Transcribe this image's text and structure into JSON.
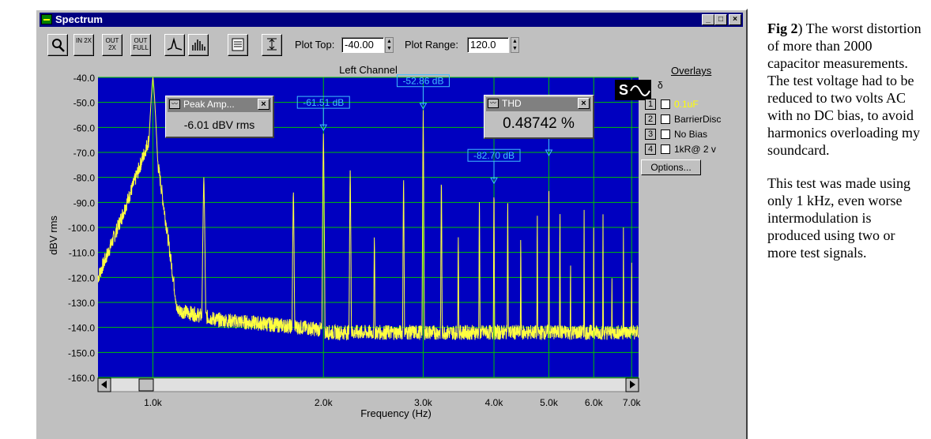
{
  "window": {
    "title": "Spectrum",
    "caption_buttons": [
      "_",
      "□",
      "×"
    ]
  },
  "toolbar": {
    "buttons": [
      {
        "name": "zoom",
        "label": ""
      },
      {
        "name": "zoom-in-2x",
        "label": "IN 2X"
      },
      {
        "name": "zoom-out-2x",
        "label": "OUT 2X"
      },
      {
        "name": "zoom-out-full",
        "label": "OUT FULL"
      },
      {
        "name": "line-mode",
        "label": ""
      },
      {
        "name": "bar-mode",
        "label": ""
      },
      {
        "name": "settings",
        "label": ""
      },
      {
        "name": "autoscale",
        "label": ""
      }
    ],
    "plot_top_label": "Plot Top:",
    "plot_top_value": "-40.00",
    "plot_range_label": "Plot Range:",
    "plot_range_value": "120.0"
  },
  "plot": {
    "channel_title": "Left Channel",
    "ylabel": "dBV rms",
    "xlabel": "Frequency (Hz)",
    "yticks": [
      "-40.0",
      "-50.0",
      "-60.0",
      "-70.0",
      "-80.0",
      "-90.0",
      "-100.0",
      "-110.0",
      "-120.0",
      "-130.0",
      "-140.0",
      "-150.0",
      "-160.0"
    ],
    "xticks": [
      "1.0k",
      "2.0k",
      "3.0k",
      "4.0k",
      "5.0k",
      "6.0k",
      "7.0k"
    ],
    "background_color": "#0000c0",
    "grid_color": "#00c000",
    "trace_color": "#ffff40",
    "markers": [
      {
        "label": "-61.51 dB",
        "freq": 2000,
        "db": -61.51
      },
      {
        "label": "-52.86 dB",
        "freq": 3000,
        "db": -52.86
      },
      {
        "label": "-82.70 dB",
        "freq": 4000,
        "db": -82.7
      }
    ]
  },
  "chart_data": {
    "type": "line",
    "title": "Left Channel",
    "xlabel": "Frequency (Hz)",
    "ylabel": "dBV rms",
    "ylim": [
      -160,
      -40
    ],
    "xscale": "log",
    "grid": true,
    "series": [
      {
        "values_description_peaks": "peaks",
        "x": [
          1000,
          1230,
          1770,
          2000,
          2230,
          2460,
          2770,
          3000,
          3230,
          3460,
          3770,
          4000,
          4230,
          4460,
          4770,
          5000,
          5230,
          5460,
          5770,
          6000,
          6230,
          6460,
          6770,
          7000
        ],
        "y": [
          -40,
          -80,
          -85,
          -61.5,
          -77,
          -103,
          -79,
          -52.9,
          -79,
          -103,
          -86,
          -82.7,
          -86,
          -102,
          -93,
          -78,
          -91,
          -110,
          -93,
          -96,
          -91,
          -114,
          -98,
          -107
        ]
      }
    ]
  },
  "peak_amp": {
    "title": "Peak Amp...",
    "value": "-6.01 dBV rms"
  },
  "thd": {
    "title": "THD",
    "value": "0.48742 %"
  },
  "overlays": {
    "title": "Overlays",
    "items": [
      {
        "num": "1",
        "label": "0.1uF",
        "color": "#ffff00"
      },
      {
        "num": "2",
        "label": "BarrierDisc",
        "color": "#000000"
      },
      {
        "num": "3",
        "label": "No Bias",
        "color": "#000000"
      },
      {
        "num": "4",
        "label": "1kR@ 2 v",
        "color": "#000000"
      }
    ],
    "options_label": "Options..."
  },
  "caption": {
    "fig_label": "Fig 2",
    "para1": ") The worst distortion of more than 2000 capacitor measurements. The test voltage had to be reduced to two volts AC with no DC bias, to avoid harmonics overloading my soundcard.",
    "para2": "This test was made using only 1 kHz, even worse intermodulation is produced using two or more test signals."
  }
}
